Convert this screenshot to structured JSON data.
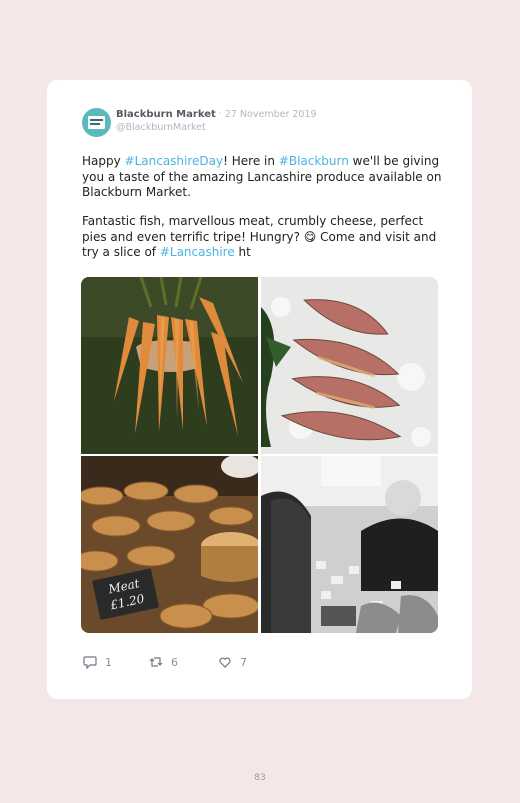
{
  "tweet": {
    "account_name": "Blackburn Market",
    "date_sep": " · ",
    "date": "27 November 2019",
    "handle": "@BlackburnMarket",
    "p1": {
      "a": "Happy ",
      "tag1": "#LancashireDay",
      "b": "! Here in ",
      "tag2": "#Blackburn",
      "c": " we'll be giving you a taste of the amazing Lancashire produce available on Blackburn Market."
    },
    "p2": {
      "a": "Fantastic fish, marvellous meat, crumbly cheese, perfect pies and even terrific tripe! Hungry? 😋 Come and visit and try a slice of ",
      "tag": "#Lancashire",
      "b": " ht"
    },
    "photos": {
      "pie_sign_line1": "Meat",
      "pie_sign_line2": "£1.20"
    },
    "stats": {
      "replies": "1",
      "retweets": "6",
      "likes": "7"
    }
  },
  "page_number": "83",
  "icons": [
    "reply-icon",
    "retweet-icon",
    "like-icon"
  ],
  "colors": {
    "accent": "#4ab3e6",
    "background": "#f5e6e8",
    "avatar": "#5ab9bb"
  }
}
